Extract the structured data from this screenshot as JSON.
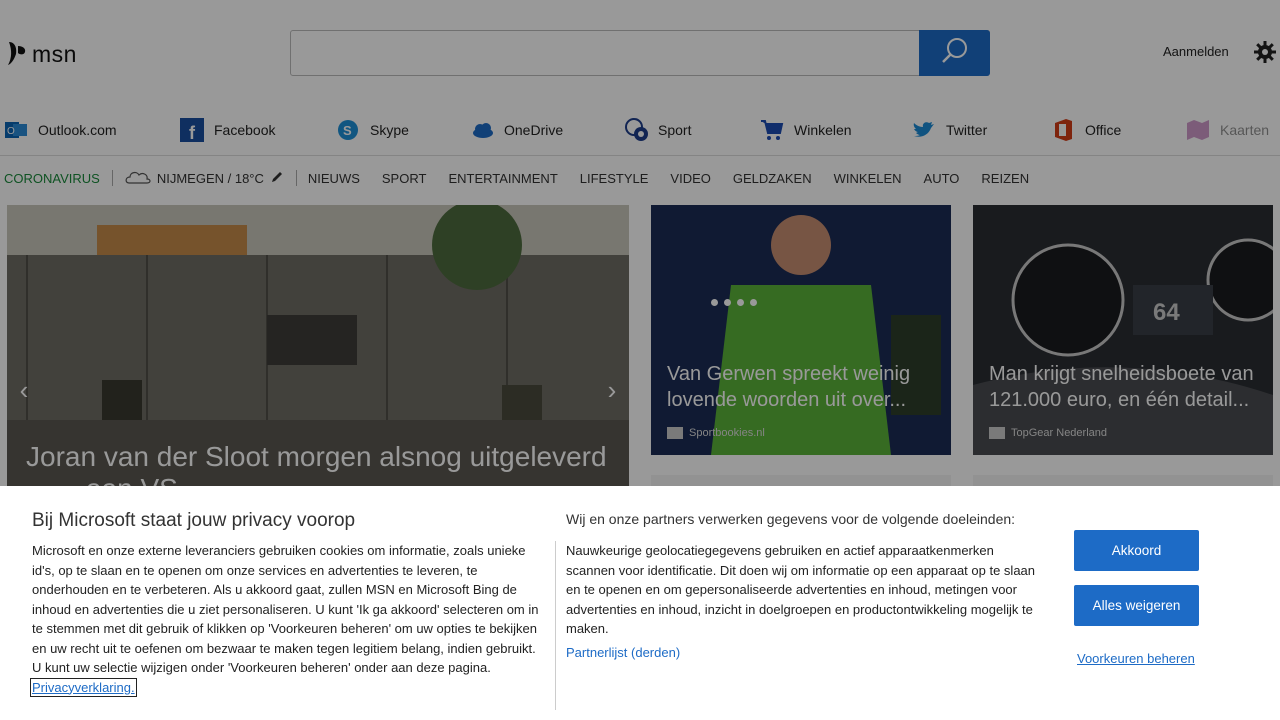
{
  "header": {
    "logo_text": "msn",
    "search_value": "",
    "signin_label": "Aanmelden"
  },
  "quicklinks": [
    {
      "label": "Outlook.com",
      "icon": "outlook-icon",
      "color": "#0a64b5"
    },
    {
      "label": "Facebook",
      "icon": "facebook-icon",
      "color": "#1a4fa0"
    },
    {
      "label": "Skype",
      "icon": "skype-icon",
      "color": "#1d8fd8"
    },
    {
      "label": "OneDrive",
      "icon": "onedrive-icon",
      "color": "#1d6bc6"
    },
    {
      "label": "Sport",
      "icon": "sport-icon",
      "color": "#1d3d8a"
    },
    {
      "label": "Winkelen",
      "icon": "shopping-cart-icon",
      "color": "#1b4bb2"
    },
    {
      "label": "Twitter",
      "icon": "twitter-icon",
      "color": "#1c8ad6"
    },
    {
      "label": "Office",
      "icon": "office-icon",
      "color": "#d23c16"
    },
    {
      "label": "Kaarten",
      "icon": "maps-icon",
      "color": "#a03596"
    }
  ],
  "nav": {
    "corona": "CORONAVIRUS",
    "weather": "NIJMEGEN / 18°C",
    "items": [
      "NIEUWS",
      "SPORT",
      "ENTERTAINMENT",
      "LIFESTYLE",
      "VIDEO",
      "GELDZAKEN",
      "WINKELEN",
      "AUTO",
      "REIZEN"
    ]
  },
  "cards": {
    "hero_title": "Joran van der Sloot morgen alsnog uitgeleverd",
    "hero_title_cont": "aan VS",
    "card2_title": "Van Gerwen spreekt weinig lovende woorden uit over...",
    "card2_source": "Sportbookies.nl",
    "card3_title": "Man krijgt snelheidsboete van 121.000 euro, en één detail...",
    "card3_source": "TopGear Nederland"
  },
  "banner": {
    "title": "Bij Microsoft staat jouw privacy voorop",
    "body": "Microsoft en onze externe leveranciers gebruiken cookies om informatie, zoals unieke id's, op te slaan en te openen om onze services en advertenties te leveren, te onderhouden en te verbeteren. Als u akkoord gaat, zullen MSN en Microsoft Bing de inhoud en advertenties die u ziet personaliseren. U kunt 'Ik ga akkoord' selecteren om in te stemmen met dit gebruik of klikken op 'Voorkeuren beheren' om uw opties te bekijken en uw recht uit te oefenen om bezwaar te maken tegen legitiem belang, indien gebruikt. U kunt uw selectie wijzigen onder 'Voorkeuren beheren' onder aan deze pagina.",
    "privacy_link": "Privacyverklaring.",
    "right_heading": "Wij en onze partners verwerken gegevens voor de volgende doeleinden:",
    "right_body": "Nauwkeurige geolocatiegegevens gebruiken en actief apparaatkenmerken scannen voor identificatie. Dit doen wij om informatie op een apparaat op te slaan en te openen en om gepersonaliseerde advertenties en inhoud, metingen voor advertenties en inhoud, inzicht in doelgroepen en productontwikkeling mogelijk te maken.",
    "partners_link": "Partnerlijst (derden)",
    "accept_label": "Akkoord",
    "reject_label": "Alles weigeren",
    "prefs_label": "Voorkeuren beheren"
  }
}
